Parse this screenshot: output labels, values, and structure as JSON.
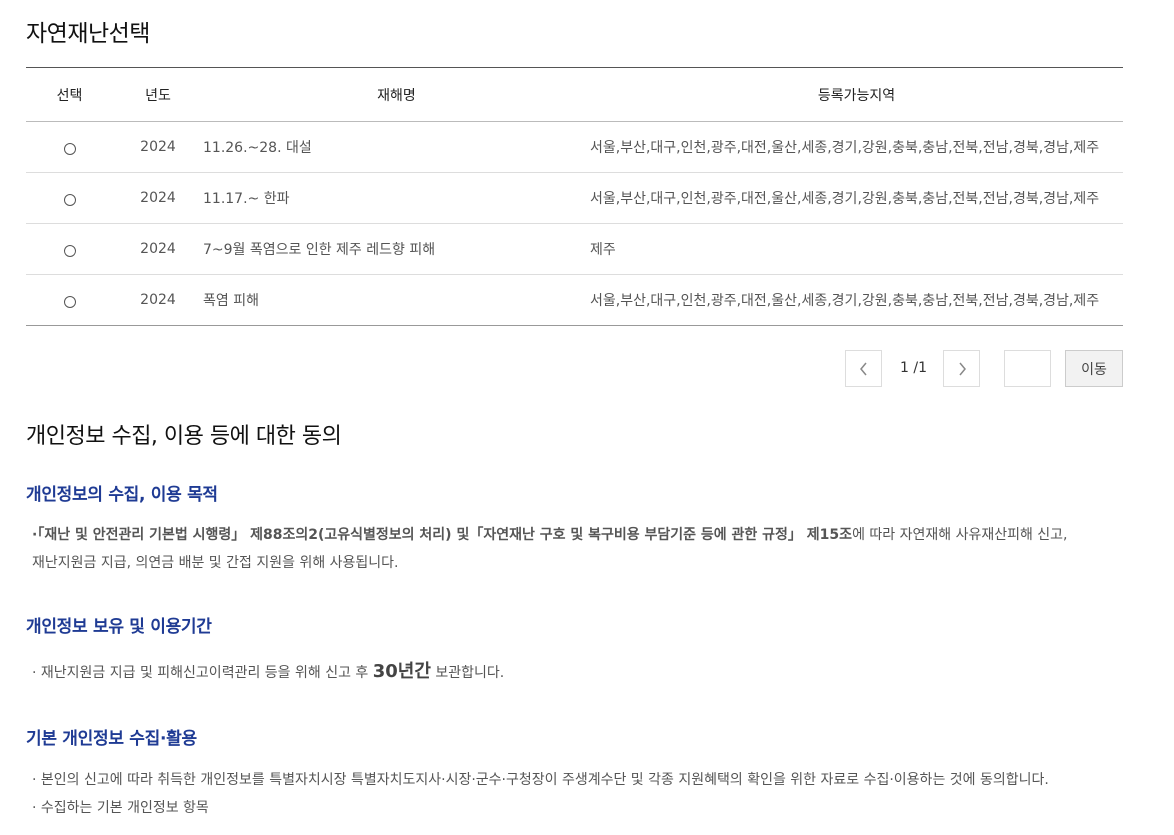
{
  "page_title": "자연재난선택",
  "table": {
    "headers": {
      "select": "선택",
      "year": "년도",
      "name": "재해명",
      "regions": "등록가능지역"
    },
    "rows": [
      {
        "year": "2024",
        "name": "11.26.~28. 대설",
        "regions": "서울,부산,대구,인천,광주,대전,울산,세종,경기,강원,충북,충남,전북,전남,경북,경남,제주"
      },
      {
        "year": "2024",
        "name": "11.17.~ 한파",
        "regions": "서울,부산,대구,인천,광주,대전,울산,세종,경기,강원,충북,충남,전북,전남,경북,경남,제주"
      },
      {
        "year": "2024",
        "name": "7~9월 폭염으로 인한 제주 레드향 피해",
        "regions": "제주"
      },
      {
        "year": "2024",
        "name": "폭염 피해",
        "regions": "서울,부산,대구,인천,광주,대전,울산,세종,경기,강원,충북,충남,전북,전남,경북,경남,제주"
      }
    ]
  },
  "pagination": {
    "info": "1 /1",
    "go_label": "이동",
    "page_input_value": ""
  },
  "consent": {
    "title": "개인정보 수집, 이용 등에 대한 동의",
    "s1_title": "개인정보의 수집, 이용 목적",
    "s1_p1_a": "·「재난 및 안전관리 기본법 시행령」 제88조의2(고유식별정보의 처리) 및「자연재난 구호 및 복구비용 부담기준 등에 관한 규정」 제15조",
    "s1_p1_b": "에 따라 자연재해 사유재산피해 신고,",
    "s1_p2": "재난지원금 지급, 의연금 배분 및 간접 지원을 위해 사용됩니다.",
    "s2_title": "개인정보 보유 및 이용기간",
    "s2_p_a": "· 재난지원금 지급 및 피해신고이력관리 등을 위해 신고 후 ",
    "s2_p_big": "30년간",
    "s2_p_b": " 보관합니다.",
    "s3_title": "기본 개인정보 수집·활용",
    "s3_p1": "· 본인의 신고에 따라 취득한 개인정보를 특별자치시장 특별자치도지사·시장·군수·구청장이 주생계수단 및 각종 지원혜택의 확인을 위한 자료로 수집·이용하는 것에 동의합니다.",
    "s3_p2": "· 수집하는 기본 개인정보 항목"
  }
}
